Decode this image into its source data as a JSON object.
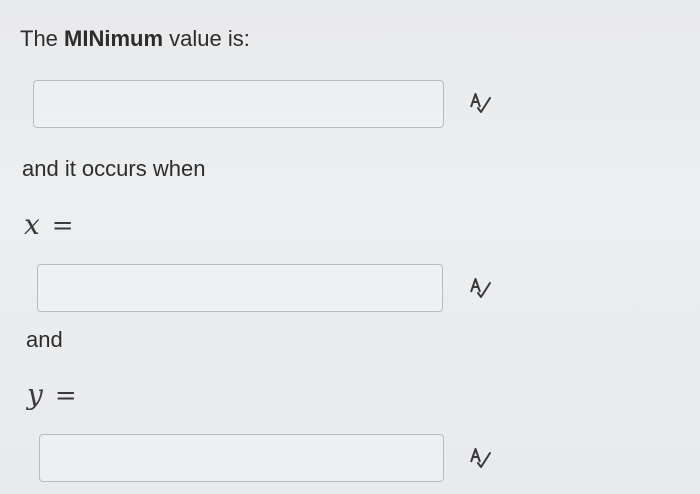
{
  "question": {
    "min_label_prefix": "The ",
    "min_label_bold": "MINimum",
    "min_label_suffix": " value is:",
    "occurs_label": "and it occurs when",
    "x_var": "x",
    "y_var": "y",
    "equals": "=",
    "and_label": "and"
  },
  "answers": {
    "minimum_value": "",
    "x_value": "",
    "y_value": ""
  },
  "icons": {
    "check_icon": "spell-check-icon"
  }
}
